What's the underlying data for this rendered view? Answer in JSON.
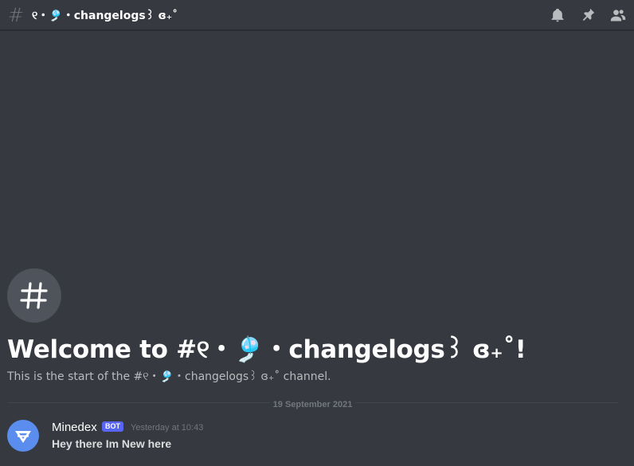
{
  "header": {
    "channel_name": "୧・🎐・changelogs꒱ ɞ₊˚",
    "icons": [
      "notification-bell-icon",
      "pin-icon",
      "member-list-icon"
    ]
  },
  "welcome": {
    "title": "Welcome to #୧・🎐・changelogs꒱ ɞ₊˚!",
    "subtitle": "This is the start of the #୧・🎐・changelogs꒱ ɞ₊˚ channel."
  },
  "divider": {
    "date": "19 September 2021"
  },
  "message": {
    "author": "Minedex",
    "tag": "BOT",
    "timestamp": "Yesterday at 10:43",
    "text": "Hey there Im New here"
  },
  "colors": {
    "background": "#36393f",
    "bot_tag": "#5865f2",
    "avatar": "#5b8def"
  }
}
